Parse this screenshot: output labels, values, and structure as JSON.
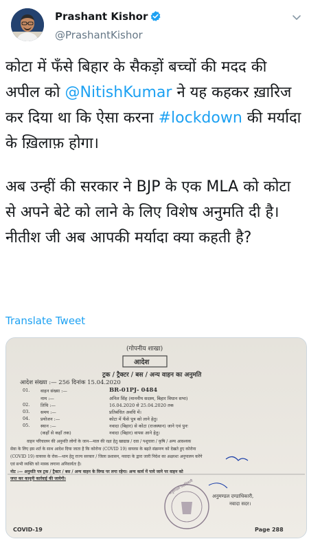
{
  "author": {
    "name": "Prashant Kishor",
    "handle": "@PrashantKishor"
  },
  "tweet": {
    "para1_before": "कोटा में फँसे बिहार के सैकड़ों बच्चों की मदद की अपील को ",
    "mention": "@NitishKumar",
    "para1_middle": " ने यह कहकर ख़ारिज कर दिया था कि ऐसा करना ",
    "hashtag": "#lockdown",
    "para1_after": " की मर्यादा के ख़िलाफ़ होगा।",
    "para2": "अब उन्हीं की सरकार ने BJP के एक MLA को कोटा से अपने बेटे को लाने के लिए विशेष अनुमति दी है। नीतीश जी अब आपकी मर्यादा क्या कहती है?"
  },
  "translate_label": "Translate Tweet",
  "document": {
    "top_stamp": "(गोपनीय शाखा)",
    "order_box": "आदेश",
    "heading": "ट्रक / ट्रैक्टर / बस / अन्य वाहन का अनुमति",
    "order_line": "आदेश संख्या :— 256 दिनांक 15.04.2020",
    "rows": [
      {
        "num": "01.",
        "label": "वाहन संख्या :—",
        "value": "BR-01PJ- 0484"
      },
      {
        "num": "",
        "label": "नाम :—",
        "value": "अनिल सिंह (माननीय सदस्य, बिहार विधान सभा)"
      },
      {
        "num": "02.",
        "label": "तिथि :—",
        "value": "16.04.2020 से 25.04.2020 तक"
      },
      {
        "num": "03.",
        "label": "समय :—",
        "value": "प्रतिबंधित अवधि में।"
      },
      {
        "num": "04.",
        "label": "प्रयोजन :—",
        "value": "कोटा में फँसे पुत्र को लाने हेतु।"
      },
      {
        "num": "05.",
        "label": "स्थान :—",
        "value": "नवादा (बिहार) से कोटा (राजस्थान) जाने एवं पुनः"
      },
      {
        "num": "",
        "label": "(कहाँ से कहाँ तक)",
        "value": "नवादा (बिहार) वापस आने हेतु।"
      }
    ],
    "body_lines": [
      "वाहन परिचालन की अनुमति लोगों के जान—माल की रक्षा हेतु खाद्यान्न / दवा / पशुचारा / कृषि / अन्य आवश्यक",
      "सेवा के लिए इस शर्त के साथ आदेश दिया जाता है कि कोरोना (COVID 19) वायरस के बढ़ते संक्रमण को देखते हुए कोरोना",
      "(COVID 19) वायरस के रोक—थाम हेतु राज्य सरकार / जिला प्रशासन, नवादा के द्वारा जारी निदेश का अक्षरशः अनुपालन करेंगे",
      "एवं सभी व्यक्ति को मास्क लगाना अनिवार्यतः है।"
    ],
    "note_line1": "नोट :— अनुमति पत्र ट्रक / ट्रैक्टर / बस / अन्य वाहन के विण्ड पर लगा रहेगा। अन्य कार्य में पाये जाने पर वाहन को",
    "note_line2": "जप्त कर कानूनी कार्रवाई की जायेगी।",
    "seal_text": "अनुमण्डल पदाधिकारी",
    "signatory_line1": "अनुमण्डल दण्डाधिकारी,",
    "signatory_line2": "नवादा सदर।",
    "footer_left": "COVID-19",
    "footer_right": "Page 288"
  },
  "colors": {
    "link": "#1da1f2",
    "text": "#14171a",
    "muted": "#657786",
    "verified": "#1da1f2"
  }
}
